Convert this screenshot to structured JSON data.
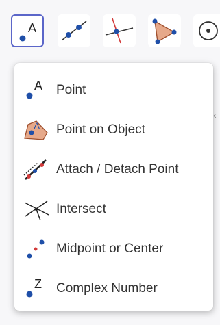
{
  "toolbar": {
    "tools": [
      {
        "name": "point-tool",
        "icon": "point-a-icon",
        "active": true
      },
      {
        "name": "line-tool",
        "icon": "line-icon",
        "active": false
      },
      {
        "name": "perpendicular-tool",
        "icon": "perpendicular-icon",
        "active": false
      },
      {
        "name": "polygon-tool",
        "icon": "polygon-icon",
        "active": false
      },
      {
        "name": "circle-tool",
        "icon": "circle-icon",
        "active": false
      }
    ]
  },
  "menu": {
    "items": [
      {
        "label": "Point",
        "icon": "point-a-icon"
      },
      {
        "label": "Point on Object",
        "icon": "point-on-object-icon"
      },
      {
        "label": "Attach / Detach Point",
        "icon": "attach-detach-icon"
      },
      {
        "label": "Intersect",
        "icon": "intersect-icon"
      },
      {
        "label": "Midpoint or Center",
        "icon": "midpoint-icon"
      },
      {
        "label": "Complex Number",
        "icon": "complex-number-icon"
      }
    ],
    "point_letter": "A",
    "complex_letter": "Z"
  },
  "colors": {
    "accent": "#5b66c9",
    "point_blue": "#1f4fa8",
    "point_red": "#d23a3a",
    "polygon_fill": "#e6a98a"
  }
}
